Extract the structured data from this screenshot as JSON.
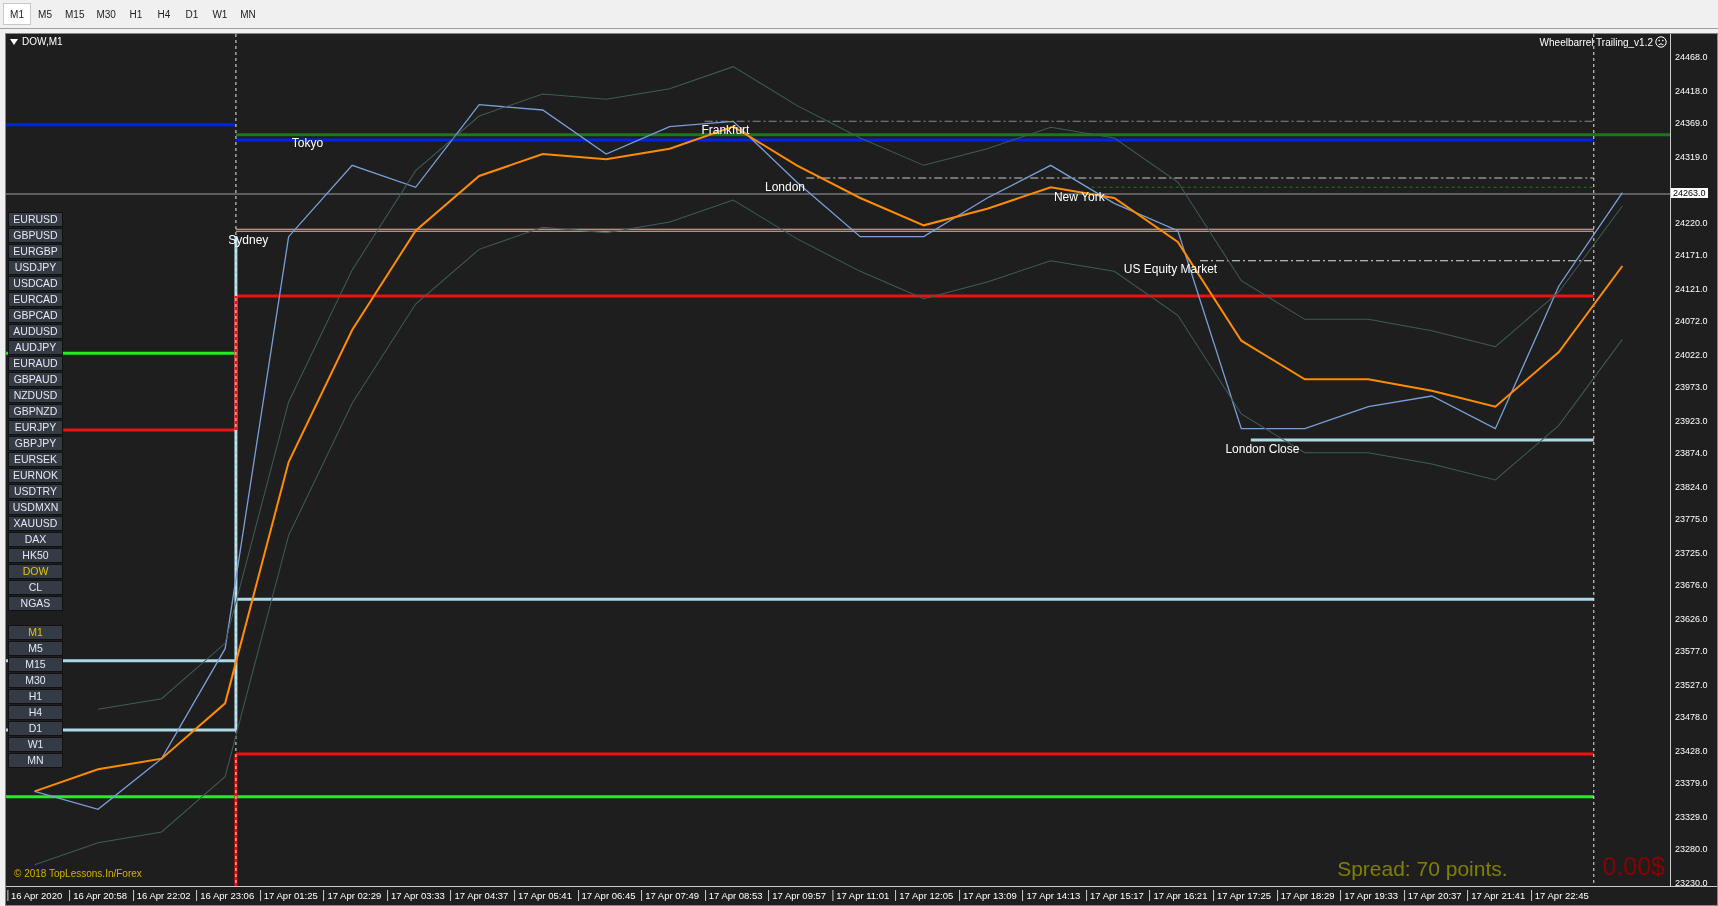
{
  "toolbar": {
    "timeframes": [
      {
        "label": "M1",
        "selected": true
      },
      {
        "label": "M5",
        "selected": false
      },
      {
        "label": "M15",
        "selected": false
      },
      {
        "label": "M30",
        "selected": false
      },
      {
        "label": "H1",
        "selected": false
      },
      {
        "label": "H4",
        "selected": false
      },
      {
        "label": "D1",
        "selected": false
      },
      {
        "label": "W1",
        "selected": false
      },
      {
        "label": "MN",
        "selected": false
      }
    ]
  },
  "chart": {
    "title": "DOW,M1",
    "indicator": "Wheelbarrel Trailing_v1.2",
    "symbols": [
      {
        "label": "EURUSD",
        "selected": false
      },
      {
        "label": "GBPUSD",
        "selected": false
      },
      {
        "label": "EURGBP",
        "selected": false
      },
      {
        "label": "USDJPY",
        "selected": false
      },
      {
        "label": "USDCAD",
        "selected": false
      },
      {
        "label": "EURCAD",
        "selected": false
      },
      {
        "label": "GBPCAD",
        "selected": false
      },
      {
        "label": "AUDUSD",
        "selected": false
      },
      {
        "label": "AUDJPY",
        "selected": false
      },
      {
        "label": "EURAUD",
        "selected": false
      },
      {
        "label": "GBPAUD",
        "selected": false
      },
      {
        "label": "NZDUSD",
        "selected": false
      },
      {
        "label": "GBPNZD",
        "selected": false
      },
      {
        "label": "EURJPY",
        "selected": false
      },
      {
        "label": "GBPJPY",
        "selected": false
      },
      {
        "label": "EURSEK",
        "selected": false
      },
      {
        "label": "EURNOK",
        "selected": false
      },
      {
        "label": "USDTRY",
        "selected": false
      },
      {
        "label": "USDMXN",
        "selected": false
      },
      {
        "label": "XAUUSD",
        "selected": false
      },
      {
        "label": "DAX",
        "selected": false
      },
      {
        "label": "HK50",
        "selected": false
      },
      {
        "label": "DOW",
        "selected": true
      },
      {
        "label": "CL",
        "selected": false
      },
      {
        "label": "NGAS",
        "selected": false
      }
    ],
    "periods": [
      {
        "label": "M1",
        "selected": true
      },
      {
        "label": "M5",
        "selected": false
      },
      {
        "label": "M15",
        "selected": false
      },
      {
        "label": "M30",
        "selected": false
      },
      {
        "label": "H1",
        "selected": false
      },
      {
        "label": "H4",
        "selected": false
      },
      {
        "label": "D1",
        "selected": false
      },
      {
        "label": "W1",
        "selected": false
      },
      {
        "label": "MN",
        "selected": false
      }
    ],
    "copyright": "© 2018 TopLessons.In/Forex",
    "spread": "Spread: 70 points.",
    "profit": "0.00$",
    "current_price": "24263.0",
    "chart_data": {
      "type": "line",
      "ylim": [
        23225,
        24503
      ],
      "categories": [
        "16 Apr 2020",
        "16 Apr 20:58",
        "16 Apr 22:02",
        "16 Apr 23:06",
        "17 Apr 01:25",
        "17 Apr 02:29",
        "17 Apr 03:33",
        "17 Apr 04:37",
        "17 Apr 05:41",
        "17 Apr 06:45",
        "17 Apr 07:49",
        "17 Apr 08:53",
        "17 Apr 09:57",
        "17 Apr 11:01",
        "17 Apr 12:05",
        "17 Apr 13:09",
        "17 Apr 14:13",
        "17 Apr 15:17",
        "17 Apr 16:21",
        "17 Apr 17:25",
        "17 Apr 18:29",
        "17 Apr 19:33",
        "17 Apr 20:37",
        "17 Apr 21:41",
        "17 Apr 22:45",
        null
      ],
      "series": [
        {
          "color": "#7a9fd8",
          "values": [
            23367,
            23340,
            23416,
            23581,
            24199,
            24306,
            24273,
            24397,
            24389,
            24323,
            24364,
            24372,
            24281,
            24199,
            24199,
            24257,
            24306,
            24249,
            24208,
            23911,
            23911,
            23944,
            23960,
            23911,
            24125,
            24265
          ]
        },
        {
          "color": "#ff8c00",
          "values": [
            23367,
            23400,
            23416,
            23499,
            23861,
            24059,
            24208,
            24290,
            24323,
            24315,
            24331,
            24364,
            24306,
            24257,
            24216,
            24241,
            24273,
            24257,
            24191,
            24043,
            23985,
            23985,
            23968,
            23944,
            24026,
            24155
          ]
        },
        {
          "color": "#3f5c57",
          "values": [
            null,
            23490,
            23506,
            23589,
            23951,
            24149,
            24298,
            24380,
            24413,
            24405,
            24421,
            24454,
            24396,
            24347,
            24306,
            24331,
            24363,
            24347,
            24281,
            24133,
            24075,
            24075,
            24058,
            24034,
            24116,
            24245
          ]
        },
        {
          "color": "#3f5c57",
          "values": [
            23257,
            23290,
            23306,
            23389,
            23751,
            23949,
            24098,
            24180,
            24213,
            24205,
            24221,
            24254,
            24196,
            24147,
            24106,
            24131,
            24163,
            24147,
            24081,
            23933,
            23875,
            23875,
            23858,
            23834,
            23916,
            24045
          ]
        }
      ],
      "yticks": [
        {
          "value": 24468,
          "label": "24468.0"
        },
        {
          "value": 24418,
          "label": "24418.0"
        },
        {
          "value": 24369,
          "label": "24369.0"
        },
        {
          "value": 24319,
          "label": "24319.0"
        },
        {
          "value": 24220,
          "label": "24220.0"
        },
        {
          "value": 24171,
          "label": "24171.0"
        },
        {
          "value": 24121,
          "label": "24121.0"
        },
        {
          "value": 24072,
          "label": "24072.0"
        },
        {
          "value": 24022,
          "label": "24022.0"
        },
        {
          "value": 23973,
          "label": "23973.0"
        },
        {
          "value": 23923,
          "label": "23923.0"
        },
        {
          "value": 23874,
          "label": "23874.0"
        },
        {
          "value": 23824,
          "label": "23824.0"
        },
        {
          "value": 23775,
          "label": "23775.0"
        },
        {
          "value": 23725,
          "label": "23725.0"
        },
        {
          "value": 23676,
          "label": "23676.0"
        },
        {
          "value": 23626,
          "label": "23626.0"
        },
        {
          "value": 23577,
          "label": "23577.0"
        },
        {
          "value": 23527,
          "label": "23527.0"
        },
        {
          "value": 23478,
          "label": "23478.0"
        },
        {
          "value": 23428,
          "label": "23428.0"
        },
        {
          "value": 23379,
          "label": "23379.0"
        },
        {
          "value": 23329,
          "label": "23329.0"
        },
        {
          "value": 23280,
          "label": "23280.0"
        },
        {
          "value": 23230,
          "label": "23230.0"
        }
      ],
      "annotations": [
        "Tokyo",
        "Sydney",
        "Frankfurt",
        "London",
        "New York",
        "US Equity Market",
        "London Close"
      ]
    }
  }
}
